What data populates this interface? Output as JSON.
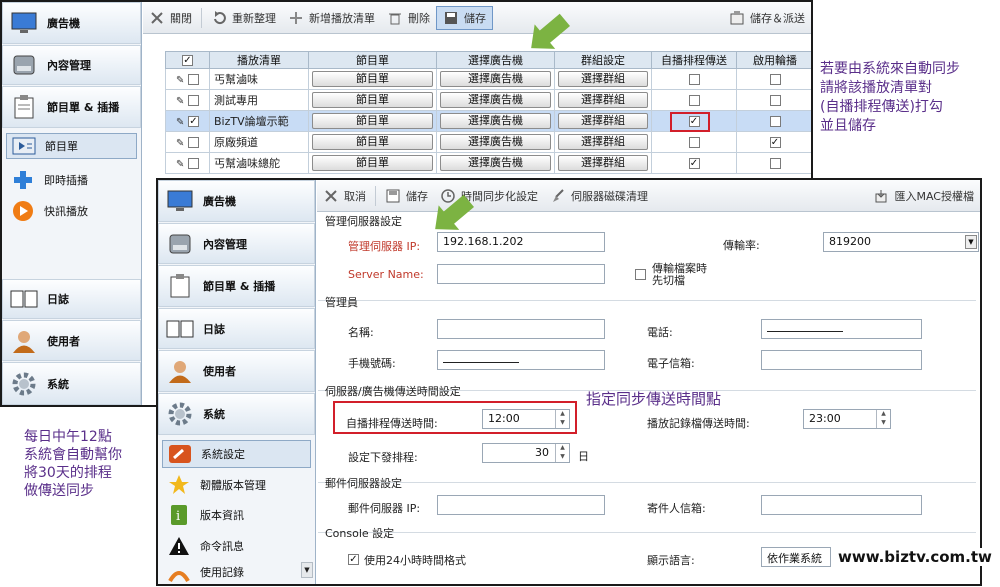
{
  "window1": {
    "sidebar": {
      "nav": [
        {
          "label": "廣告機",
          "icon": "monitor-icon"
        },
        {
          "label": "內容管理",
          "icon": "hard-drive-icon"
        },
        {
          "label": "節目單 & 插播",
          "icon": "clipboard-icon"
        }
      ],
      "subitems": [
        {
          "label": "節目單",
          "icon": "playlist-icon",
          "selected": true
        },
        {
          "label": "即時插播",
          "icon": "plus-icon"
        },
        {
          "label": "快訊播放",
          "icon": "play-icon"
        }
      ],
      "bottom_nav": [
        {
          "label": "日誌",
          "icon": "book-icon"
        },
        {
          "label": "使用者",
          "icon": "user-icon"
        },
        {
          "label": "系統",
          "icon": "gear-icon"
        }
      ]
    },
    "toolbar": {
      "close": "關閉",
      "refresh": "重新整理",
      "add_playlist": "新增播放清單",
      "delete": "刪除",
      "save": "儲存",
      "save_dispatch": "儲存＆派送"
    },
    "table": {
      "headers": [
        "",
        "播放清單",
        "節目單",
        "選擇廣告機",
        "群組設定",
        "自播排程傳送",
        "啟用輪播"
      ],
      "button_labels": {
        "program": "節目單",
        "select_player": "選擇廣告機",
        "select_group": "選擇群組"
      },
      "rows": [
        {
          "name": "丐幫滷味",
          "checked": false,
          "auto_sched": false,
          "carousel": false,
          "selected": false
        },
        {
          "name": "測試專用",
          "checked": false,
          "auto_sched": false,
          "carousel": false,
          "selected": false
        },
        {
          "name": "BizTV論壇示範",
          "checked": true,
          "auto_sched": true,
          "carousel": false,
          "selected": true
        },
        {
          "name": "原廠頻道",
          "checked": false,
          "auto_sched": false,
          "carousel": true,
          "selected": false
        },
        {
          "name": "丐幫滷味總舵",
          "checked": false,
          "auto_sched": true,
          "carousel": false,
          "selected": false
        }
      ]
    }
  },
  "window2": {
    "sidebar": {
      "nav": [
        {
          "label": "廣告機",
          "icon": "monitor-icon"
        },
        {
          "label": "內容管理",
          "icon": "hard-drive-icon"
        },
        {
          "label": "節目單 & 插播",
          "icon": "clipboard-icon"
        },
        {
          "label": "日誌",
          "icon": "book-icon"
        },
        {
          "label": "使用者",
          "icon": "user-icon"
        },
        {
          "label": "系統",
          "icon": "gear-icon"
        }
      ],
      "subitems": [
        {
          "label": "系統設定",
          "icon": "wrench-icon",
          "selected": true
        },
        {
          "label": "韌體版本管理",
          "icon": "star-icon"
        },
        {
          "label": "版本資訊",
          "icon": "info-icon"
        },
        {
          "label": "命令訊息",
          "icon": "warning-icon"
        },
        {
          "label": "使用記錄",
          "icon": "log-icon"
        }
      ]
    },
    "toolbar": {
      "cancel": "取消",
      "save": "儲存",
      "time_sync": "時間同步化設定",
      "disk_cleanup": "伺服器磁碟清理",
      "import_mac": "匯入MAC授權檔"
    },
    "form": {
      "section_server": "管理伺服器設定",
      "server_ip_label": "管理伺服器 IP:",
      "server_ip_value": "192.168.1.202",
      "baud_label": "傳輸率:",
      "baud_value": "819200",
      "server_name_label": "Server Name:",
      "server_name_value": "",
      "switch_label_line1": "傳輸檔案時",
      "switch_label_line2": "先切檔",
      "section_admin": "管理員",
      "name_label": "名稱:",
      "phone_label": "電話:",
      "mobile_label": "手機號碼:",
      "email_label": "電子信箱:",
      "section_time": "伺服器/廣告機傳送時間設定",
      "auto_sched_label": "自播排程傳送時間:",
      "auto_sched_value": "12:00",
      "log_send_label": "播放記錄檔傳送時間:",
      "log_send_value": "23:00",
      "dispatch_label": "設定下發排程:",
      "dispatch_value": "30",
      "dispatch_unit": "日",
      "section_mail": "郵件伺服器設定",
      "mail_ip_label": "郵件伺服器 IP:",
      "sender_label": "寄件人信箱:",
      "section_console": "Console 設定",
      "use24_label": "使用24小時時間格式",
      "lang_label": "顯示語言:",
      "lang_value": "依作業系統"
    }
  },
  "annotations": {
    "right_note": [
      "若要由系統來自動同步",
      "請將該播放清單對",
      "(自播排程傳送)打勾",
      "並且儲存"
    ],
    "time_note": "指定同步傳送時間點",
    "left_note": [
      "每日中午12點",
      "系統會自動幫你",
      "將30天的排程",
      "做傳送同步"
    ],
    "website": "www.biztv.com.tw"
  },
  "colors": {
    "annotation": "#5a2f8a",
    "highlight": "#d21f2a",
    "arrow": "#7cb342"
  }
}
